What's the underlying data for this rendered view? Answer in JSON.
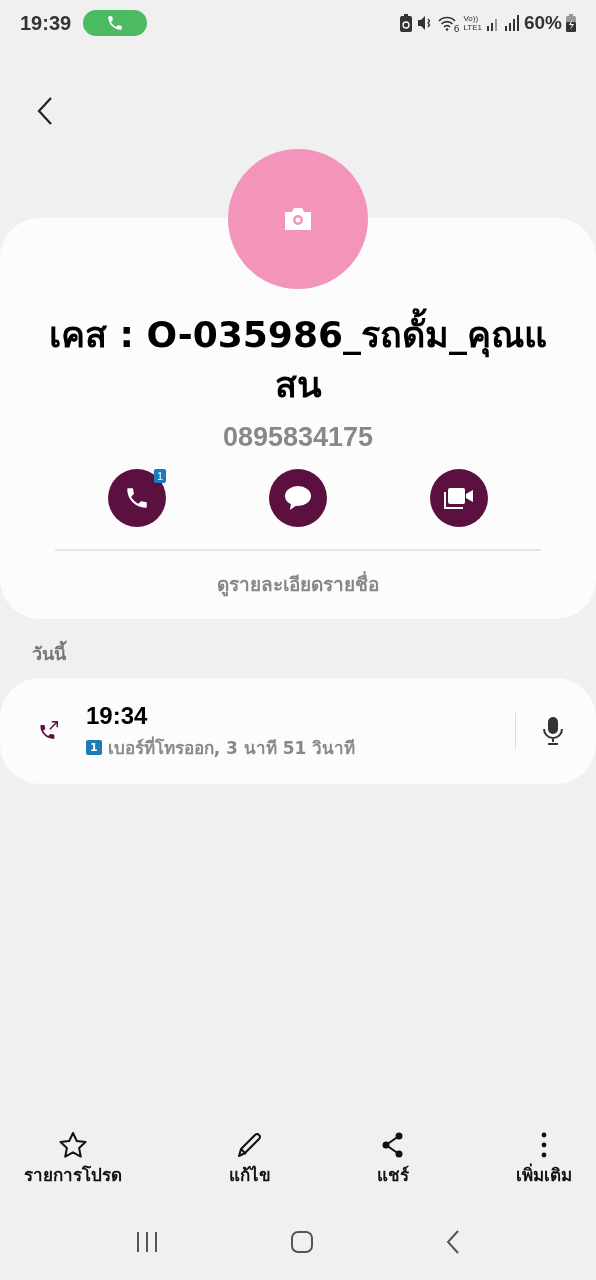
{
  "status_bar": {
    "time": "19:39",
    "wifi_label": "6",
    "network_top": "Vo))",
    "network_bottom": "LTE1",
    "battery": "60%"
  },
  "contact": {
    "name": "เคส : O-035986_รถดั้ม_คุณแสน",
    "phone": "0895834175"
  },
  "actions": [
    {
      "kind": "call",
      "badge": "1"
    },
    {
      "kind": "message"
    },
    {
      "kind": "video"
    }
  ],
  "details_link": "ดูรายละเอียดรายชื่อ",
  "log_section": {
    "title": "วันนี้",
    "entries": [
      {
        "time": "19:34",
        "sim": "1",
        "description": "เบอร์ที่โทรออก, 3 นาที 51 วินาที"
      }
    ]
  },
  "bottom_actions": [
    {
      "kind": "star",
      "label": "รายการโปรด"
    },
    {
      "kind": "edit",
      "label": "แก้ไข"
    },
    {
      "kind": "share",
      "label": "แชร์"
    },
    {
      "kind": "more",
      "label": "เพิ่มเติม"
    }
  ]
}
